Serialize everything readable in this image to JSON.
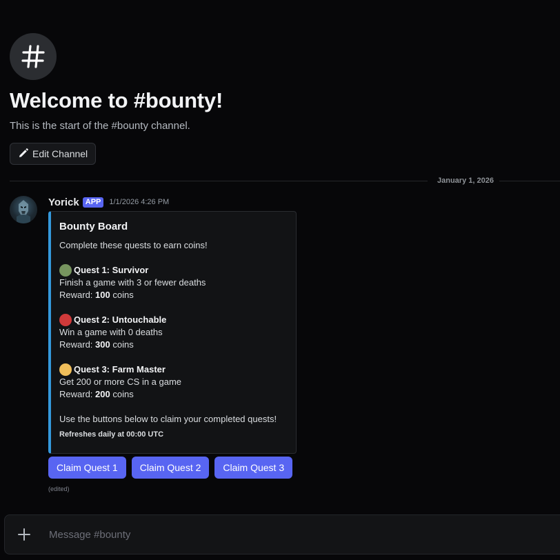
{
  "channel": {
    "welcome_title": "Welcome to #bounty!",
    "welcome_subtitle": "This is the start of the #bounty channel.",
    "edit_button_label": "Edit Channel"
  },
  "divider": {
    "date": "January 1, 2026"
  },
  "message": {
    "author": "Yorick",
    "tag": "APP",
    "timestamp": "1/1/2026 4:26 PM",
    "edited": "(edited)"
  },
  "embed": {
    "accent_color": "#3498db",
    "title": "Bounty Board",
    "intro": "Complete these quests to earn coins!",
    "quests": [
      {
        "icon": "green-circle-icon",
        "color": "#77955f",
        "title": "Quest 1: Survivor",
        "description": "Finish a game with 3 or fewer deaths",
        "reward_prefix": "Reward: ",
        "reward": "100",
        "reward_suffix": " coins"
      },
      {
        "icon": "red-circle-icon",
        "color": "#d03a3a",
        "title": "Quest 2: Untouchable",
        "description": "Win a game with 0 deaths",
        "reward_prefix": "Reward: ",
        "reward": "300",
        "reward_suffix": " coins"
      },
      {
        "icon": "yellow-circle-icon",
        "color": "#f0be5a",
        "title": "Quest 3: Farm Master",
        "description": "Get 200 or more CS in a game",
        "reward_prefix": "Reward: ",
        "reward": "200",
        "reward_suffix": " coins"
      }
    ],
    "outro": "Use the buttons below to claim your completed quests!",
    "footer": "Refreshes daily at 00:00 UTC"
  },
  "buttons": [
    "Claim Quest 1",
    "Claim Quest 2",
    "Claim Quest 3"
  ],
  "composer": {
    "placeholder": "Message #bounty"
  },
  "colors": {
    "blurple": "#5865f2",
    "background": "#070709"
  }
}
